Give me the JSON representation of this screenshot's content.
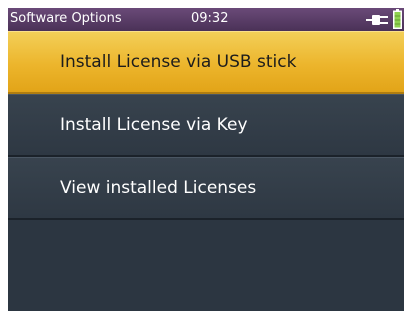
{
  "statusbar": {
    "title": "Software Options",
    "time": "09:32",
    "power_icon": "plug-icon",
    "battery_icon": "battery-icon"
  },
  "menu": {
    "items": [
      {
        "label": "Install License via USB stick",
        "selected": true
      },
      {
        "label": "Install License via Key",
        "selected": false
      },
      {
        "label": "View installed Licenses",
        "selected": false
      }
    ]
  },
  "colors": {
    "statusbar": "#5b3f69",
    "selected_item": "#ecb52c",
    "menu_background": "#2c3641",
    "battery": "#8fd14f"
  }
}
